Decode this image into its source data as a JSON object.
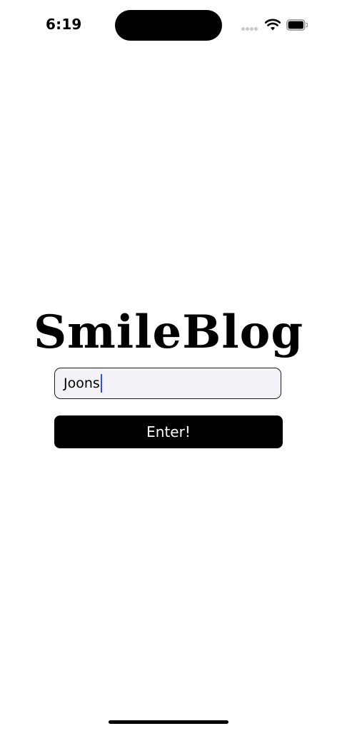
{
  "status_bar": {
    "time": "6:19",
    "icons": [
      "signal-dots-icon",
      "wifi-icon",
      "battery-icon"
    ]
  },
  "app": {
    "title": "SmileBlog"
  },
  "name_input": {
    "value": "Joons",
    "placeholder": ""
  },
  "enter_button": {
    "label": "Enter!"
  },
  "colors": {
    "background": "#ffffff",
    "input_background": "#f2f2f7",
    "button_background": "#000000",
    "button_text": "#ffffff",
    "caret": "#2f55d4"
  }
}
